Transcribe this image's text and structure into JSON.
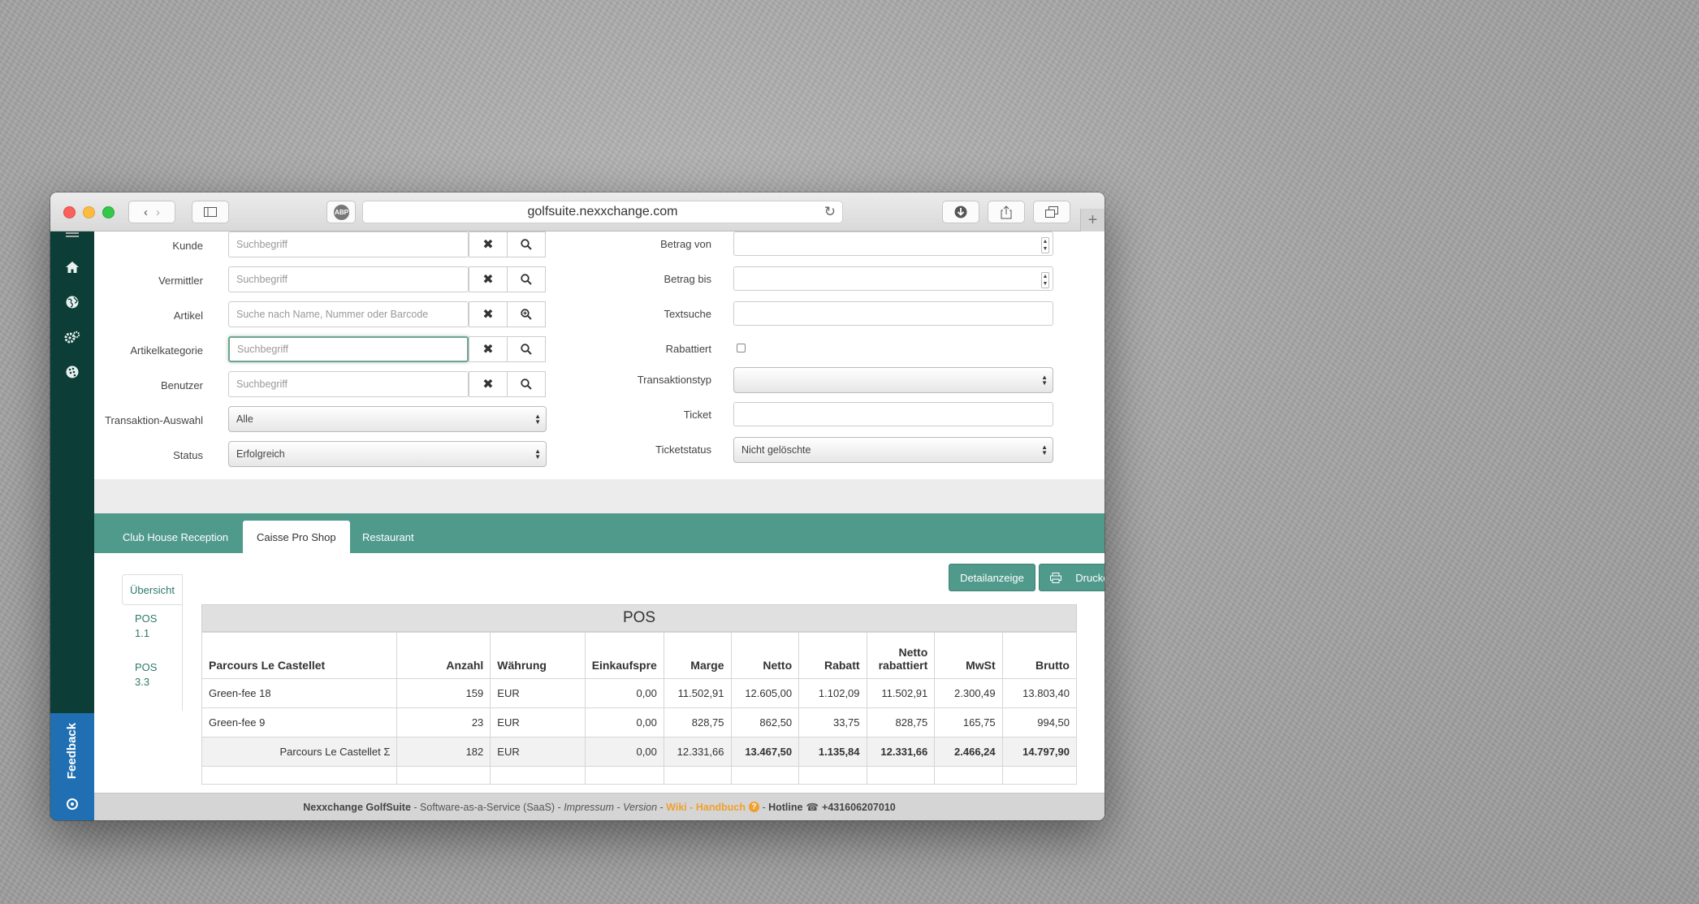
{
  "browser": {
    "url": "golfsuite.nexxchange.com",
    "abp_label": "ABP"
  },
  "filters": {
    "left": [
      {
        "label": "Kunde",
        "placeholder": "Suchbegriff"
      },
      {
        "label": "Vermittler",
        "placeholder": "Suchbegriff"
      },
      {
        "label": "Artikel",
        "placeholder": "Suche nach Name, Nummer oder Barcode"
      },
      {
        "label": "Artikelkategorie",
        "placeholder": "Suchbegriff"
      },
      {
        "label": "Benutzer",
        "placeholder": "Suchbegriff"
      }
    ],
    "transaktion_auswahl": {
      "label": "Transaktion-Auswahl",
      "value": "Alle"
    },
    "status": {
      "label": "Status",
      "value": "Erfolgreich"
    },
    "right": {
      "betrag_von": "Betrag von",
      "betrag_bis": "Betrag bis",
      "textsuche": "Textsuche",
      "rabattiert": "Rabattiert",
      "transaktionstyp": "Transaktionstyp",
      "ticket": "Ticket",
      "ticketstatus": {
        "label": "Ticketstatus",
        "value": "Nicht gelöschte"
      }
    }
  },
  "tabs": [
    "Club House Reception",
    "Caisse Pro Shop",
    "Restaurant"
  ],
  "active_tab": "Caisse Pro Shop",
  "subnav": {
    "active": "Übersicht",
    "items": [
      {
        "line1": "POS",
        "line2": "1.1"
      },
      {
        "line1": "POS",
        "line2": "3.3"
      }
    ]
  },
  "buttons": {
    "detail": "Detailanzeige",
    "print": "Drucken"
  },
  "pos_table": {
    "title": "POS",
    "headers": {
      "name": "Parcours Le Castellet",
      "anzahl": "Anzahl",
      "waehrung": "Währung",
      "einkauf": "Einkaufspre",
      "marge": "Marge",
      "netto": "Netto",
      "rabatt": "Rabatt",
      "netto_rab_1": "Netto",
      "netto_rab_2": "rabattiert",
      "mwst": "MwSt",
      "brutto": "Brutto"
    },
    "rows": [
      {
        "name": "Green-fee 18",
        "anzahl": "159",
        "waehrung": "EUR",
        "einkauf": "0,00",
        "marge": "11.502,91",
        "netto": "12.605,00",
        "rabatt": "1.102,09",
        "netto_rab": "11.502,91",
        "mwst": "2.300,49",
        "brutto": "13.803,40"
      },
      {
        "name": "Green-fee 9",
        "anzahl": "23",
        "waehrung": "EUR",
        "einkauf": "0,00",
        "marge": "828,75",
        "netto": "862,50",
        "rabatt": "33,75",
        "netto_rab": "828,75",
        "mwst": "165,75",
        "brutto": "994,50"
      }
    ],
    "total": {
      "name": "Parcours Le Castellet Σ",
      "anzahl": "182",
      "waehrung": "EUR",
      "einkauf": "0,00",
      "marge": "12.331,66",
      "netto": "13.467,50",
      "rabatt": "1.135,84",
      "netto_rab": "12.331,66",
      "mwst": "2.466,24",
      "brutto": "14.797,90"
    }
  },
  "sidebar": {
    "icons": [
      "home-icon",
      "globe-icon",
      "settings-icon",
      "golf-ball-icon"
    ],
    "feedback": "Feedback"
  },
  "footer": {
    "brand": "Nexxchange GolfSuite",
    "saas": " - Software-as-a-Service (SaaS) - ",
    "impressum": "Impressum",
    "sep1": " - ",
    "version": "Version",
    "sep2": " - ",
    "wiki": "Wiki - Handbuch",
    "sep3": " - ",
    "hotline_label": "Hotline",
    "hotline": "+431606207010"
  },
  "colors": {
    "sidebar": "#0c3e37",
    "accent_teal": "#509a8c",
    "feedback_blue": "#1f6fb2",
    "wiki_orange": "#f0a030"
  }
}
